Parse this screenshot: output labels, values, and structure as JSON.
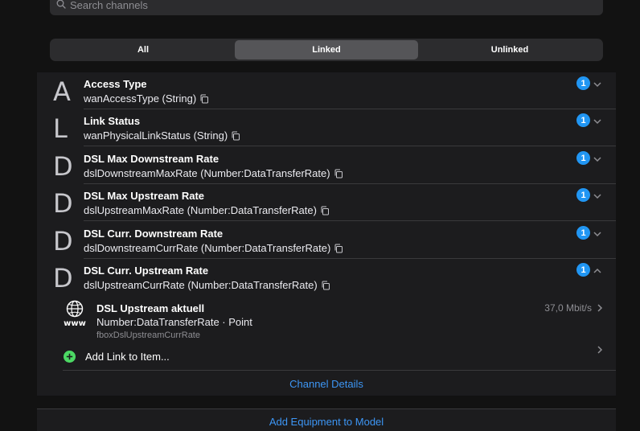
{
  "search": {
    "placeholder": "Search channels",
    "icon": "search-icon"
  },
  "filter": {
    "tabs": [
      {
        "label": "All",
        "active": false
      },
      {
        "label": "Linked",
        "active": true
      },
      {
        "label": "Unlinked",
        "active": false
      }
    ]
  },
  "channels": [
    {
      "letter": "A",
      "title": "Access Type",
      "subtitle": "wanAccessType (String)",
      "badge": "1",
      "expanded": false
    },
    {
      "letter": "L",
      "title": "Link Status",
      "subtitle": "wanPhysicalLinkStatus (String)",
      "badge": "1",
      "expanded": false
    },
    {
      "letter": "D",
      "title": "DSL Max Downstream Rate",
      "subtitle": "dslDownstreamMaxRate (Number:DataTransferRate)",
      "badge": "1",
      "expanded": false
    },
    {
      "letter": "D",
      "title": "DSL Max Upstream Rate",
      "subtitle": "dslUpstreamMaxRate (Number:DataTransferRate)",
      "badge": "1",
      "expanded": false
    },
    {
      "letter": "D",
      "title": "DSL Curr. Downstream Rate",
      "subtitle": "dslDownstreamCurrRate (Number:DataTransferRate)",
      "badge": "1",
      "expanded": false
    },
    {
      "letter": "D",
      "title": "DSL Curr. Upstream Rate",
      "subtitle": "dslUpstreamCurrRate (Number:DataTransferRate)",
      "badge": "1",
      "expanded": true
    }
  ],
  "linked_item": {
    "icon": "globe-www-icon",
    "title": "DSL Upstream aktuell",
    "type": "Number:DataTransferRate · Point",
    "name": "fboxDslUpstreamCurrRate",
    "state": "37,0 Mbit/s"
  },
  "add_link": {
    "label": "Add Link to Item..."
  },
  "channel_details": {
    "label": "Channel Details"
  },
  "footer": {
    "label": "Add Equipment to Model"
  },
  "colors": {
    "accent": "#2196f3",
    "link": "#3d96f5",
    "add": "#4cd964",
    "background": "#121212",
    "panel": "#1c1c1e"
  }
}
